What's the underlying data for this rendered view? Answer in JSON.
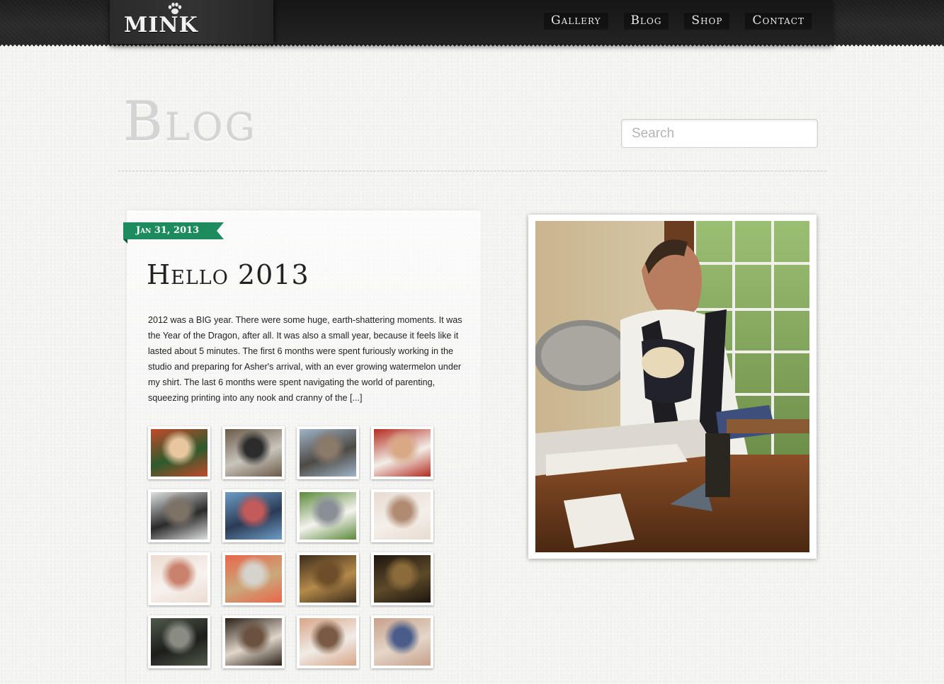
{
  "brand": {
    "logo_text": "MINK",
    "logo_icon": "paw-print-icon"
  },
  "nav": [
    {
      "label": "Gallery"
    },
    {
      "label": "Blog"
    },
    {
      "label": "Shop"
    },
    {
      "label": "Contact"
    }
  ],
  "page": {
    "title": "Blog"
  },
  "search": {
    "placeholder": "Search"
  },
  "post": {
    "date": "Jan 31, 2013",
    "title": "Hello 2013",
    "excerpt": "2012 was a BIG year.  There were some huge, earth-shattering moments. It was the Year of the Dragon, after all. It was also a small year, because it feels like it lasted about 5 minutes. The first 6 months were spent furiously working in the studio and preparing for Asher's arrival, with an ever growing watermelon under my shirt. The last 6 months were spent navigating the world of parenting, squeezing printing into any nook and cranny of the [...]"
  },
  "thumbnails": [
    {
      "name": "baby-in-green-photo",
      "colors": [
        "#c24a2b",
        "#2d5b2c",
        "#e8c7a0"
      ]
    },
    {
      "name": "man-at-press-photo",
      "colors": [
        "#6b5a48",
        "#c9c5bd",
        "#2c2c2c"
      ]
    },
    {
      "name": "group-outdoors-photo",
      "colors": [
        "#9fb4c8",
        "#4d4a45",
        "#8a7a6a"
      ]
    },
    {
      "name": "santa-with-baby-photo",
      "colors": [
        "#b32a1f",
        "#f2efe8",
        "#d9a986"
      ]
    },
    {
      "name": "man-with-machine-photo",
      "colors": [
        "#dfe0e0",
        "#2a2a2a",
        "#7d7266"
      ]
    },
    {
      "name": "family-at-beach-photo",
      "colors": [
        "#6e9dc6",
        "#2a3b55",
        "#c45b5b"
      ]
    },
    {
      "name": "wedding-couple-photo",
      "colors": [
        "#5a8a3a",
        "#f5f3ee",
        "#8a8f96"
      ]
    },
    {
      "name": "bride-dancing-photo",
      "colors": [
        "#e7dcd2",
        "#f4efe9",
        "#b08b72"
      ]
    },
    {
      "name": "bride-in-dress-photo",
      "colors": [
        "#ecdcd2",
        "#f7f2ee",
        "#c9826c"
      ]
    },
    {
      "name": "printed-cards-photo",
      "colors": [
        "#e9664a",
        "#c9a97c",
        "#d6d2cc"
      ]
    },
    {
      "name": "studio-press-photo",
      "colors": [
        "#3b2b1b",
        "#b58a4a",
        "#6e4e2a"
      ]
    },
    {
      "name": "press-wheel-photo",
      "colors": [
        "#1c150e",
        "#5e4a2a",
        "#8b6b3a"
      ]
    },
    {
      "name": "press-closeup-photo",
      "colors": [
        "#4f5a4a",
        "#1d1d1a",
        "#8a8c82"
      ]
    },
    {
      "name": "man-working-photo",
      "colors": [
        "#2a2018",
        "#e0d6ca",
        "#6a5240"
      ]
    },
    {
      "name": "father-and-baby-photo",
      "colors": [
        "#d9a487",
        "#f0ece7",
        "#7a5a44"
      ]
    },
    {
      "name": "baby-birthday-photo",
      "colors": [
        "#c7a08b",
        "#e4d6c8",
        "#4a5d8a"
      ]
    }
  ],
  "feature_image": {
    "name": "man-with-baby-at-press-photo"
  },
  "colors": {
    "accent": "#1e8b5e",
    "header_bg": "#1d1d1d",
    "page_bg": "#f4f4f3",
    "title_gray": "#d4d4d4"
  }
}
